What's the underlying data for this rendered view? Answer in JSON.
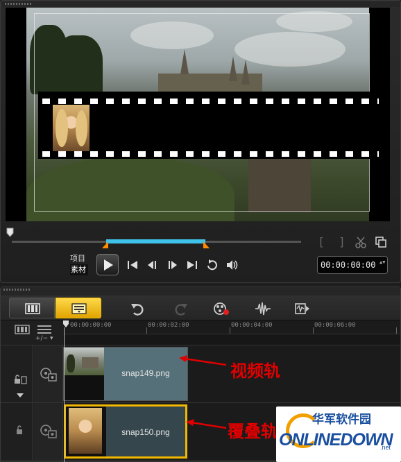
{
  "preview": {
    "mode_project": "项目",
    "mode_clip": "素材",
    "timecode": "00:00:00:00",
    "timecode_arrows": "▲▼",
    "mark_in_icon": "[",
    "mark_out_icon": "]"
  },
  "timeline": {
    "ruler_labels": [
      "00:00:00:00",
      "00:00:02:00",
      "00:00:04:00",
      "00:00:06:00"
    ],
    "zoom_label": "+/− ▾",
    "tracks": [
      {
        "name": "video-track",
        "clip_label": "snap149.png",
        "annotation": "视频轨"
      },
      {
        "name": "overlay-track",
        "clip_label": "snap150.png",
        "annotation": "覆叠轨"
      }
    ]
  },
  "watermark": {
    "cn": "华军软件园",
    "en": "ONLINEDOWN",
    "tld": ".net"
  },
  "colors": {
    "accent_yellow": "#f2b800",
    "scrub_range": "#3fc2ea",
    "annotation_red": "#e00000",
    "mark_orange": "#ff8a00"
  },
  "icons": [
    "grip-dots-icon",
    "scissors-icon",
    "copy-icon",
    "play-icon",
    "start-icon",
    "prev-frame-icon",
    "next-frame-icon",
    "end-icon",
    "repeat-icon",
    "volume-icon",
    "filmstrip-icon",
    "timeline-icon",
    "undo-icon",
    "redo-icon",
    "record-icon",
    "audio-mixer-icon",
    "auto-music-icon",
    "lock-icon",
    "video-icon",
    "overlay-icon"
  ]
}
